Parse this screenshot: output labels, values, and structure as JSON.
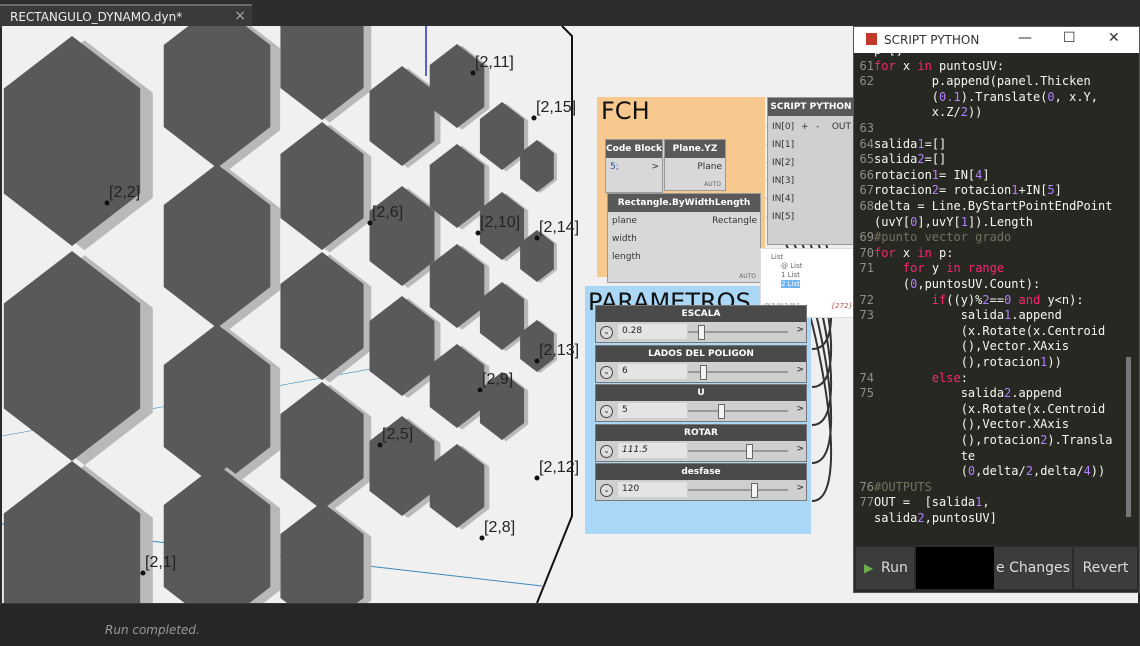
{
  "tab": {
    "title": "RECTANGULO_DYNAMO.dyn*",
    "close": "×"
  },
  "viewport": {
    "labels": [
      "[2,11]",
      "[2,15]",
      "[2,2]",
      "[2,6]",
      "[2,10]",
      "[2,14]",
      "[2,13]",
      "[2,9]",
      "[2,5]",
      "[2,12]",
      "[2,8]",
      "[2,1]"
    ]
  },
  "groups": {
    "fch": "FCH",
    "parametros": "PARAMETROS"
  },
  "nodes": {
    "code_block": {
      "title": "Code Block",
      "value": "5;",
      "out": ">"
    },
    "plane_yz": {
      "title": "Plane.YZ",
      "out": "Plane",
      "auto": "AUTO"
    },
    "rectangle": {
      "title": "Rectangle.ByWidthLength",
      "inputs": [
        "plane",
        "width",
        "length"
      ],
      "out": "Rectangle",
      "auto": "AUTO"
    },
    "script_python": {
      "title": "SCRIPT PYTHON",
      "inputs": [
        "IN[0]",
        "IN[1]",
        "IN[2]",
        "IN[3]",
        "IN[4]",
        "IN[5]"
      ],
      "add": "+",
      "remove": "-",
      "out": "OUT"
    }
  },
  "preview": {
    "lines": [
      "List",
      "@ List",
      "1 List",
      "2 List"
    ],
    "footer": "@L3 @L2 @L1",
    "count": "{272}"
  },
  "sliders": [
    {
      "name": "ESCALA",
      "value": "0.28",
      "pos": 0.1
    },
    {
      "name": "LADOS DEL POLIGON",
      "value": "6",
      "pos": 0.12
    },
    {
      "name": "U",
      "value": "5",
      "pos": 0.3
    },
    {
      "name": "ROTAR",
      "value": "111.5",
      "pos": 0.58
    },
    {
      "name": "desfase",
      "value": "120",
      "pos": 0.63
    }
  ],
  "python_window": {
    "title": "SCRIPT PYTHON",
    "minimize": "—",
    "maximize": "☐",
    "close": "✕",
    "code": [
      {
        "n": "",
        "t": "p=[]"
      },
      {
        "n": "61",
        "t": "for x in puntosUV:"
      },
      {
        "n": "62",
        "t": "        p.append(panel.Thicken"
      },
      {
        "n": "",
        "t": "        (0.1).Translate(0, x.Y,"
      },
      {
        "n": "",
        "t": "        x.Z/2))"
      },
      {
        "n": "63",
        "t": ""
      },
      {
        "n": "64",
        "t": "salida1=[]"
      },
      {
        "n": "65",
        "t": "salida2=[]"
      },
      {
        "n": "66",
        "t": "rotacion1= IN[4]"
      },
      {
        "n": "67",
        "t": "rotacion2= rotacion1+IN[5]"
      },
      {
        "n": "68",
        "t": "delta = Line.ByStartPointEndPoint"
      },
      {
        "n": "",
        "t": "(uvY[0],uvY[1]).Length"
      },
      {
        "n": "69",
        "t": "#punto vector grado"
      },
      {
        "n": "70",
        "t": "for x in p:"
      },
      {
        "n": "71",
        "t": "    for y in range"
      },
      {
        "n": "",
        "t": "    (0,puntosUV.Count):"
      },
      {
        "n": "72",
        "t": "        if((y)%2==0 and y<n):"
      },
      {
        "n": "73",
        "t": "            salida1.append"
      },
      {
        "n": "",
        "t": "            (x.Rotate(x.Centroid"
      },
      {
        "n": "",
        "t": "            (),Vector.XAxis"
      },
      {
        "n": "",
        "t": "            (),rotacion1))"
      },
      {
        "n": "74",
        "t": "        else:"
      },
      {
        "n": "75",
        "t": "            salida2.append"
      },
      {
        "n": "",
        "t": "            (x.Rotate(x.Centroid"
      },
      {
        "n": "",
        "t": "            (),Vector.XAxis"
      },
      {
        "n": "",
        "t": "            (),rotacion2).Transla"
      },
      {
        "n": "",
        "t": "            te"
      },
      {
        "n": "",
        "t": "            (0,delta/2,delta/4))"
      },
      {
        "n": "76",
        "t": "#OUTPUTS"
      },
      {
        "n": "77",
        "t": "OUT =  [salida1,"
      },
      {
        "n": "",
        "t": "salida2,puntosUV]"
      }
    ],
    "buttons": {
      "run": "Run",
      "save": "e Changes",
      "revert": "Revert"
    }
  },
  "status": {
    "text": "Run completed."
  }
}
